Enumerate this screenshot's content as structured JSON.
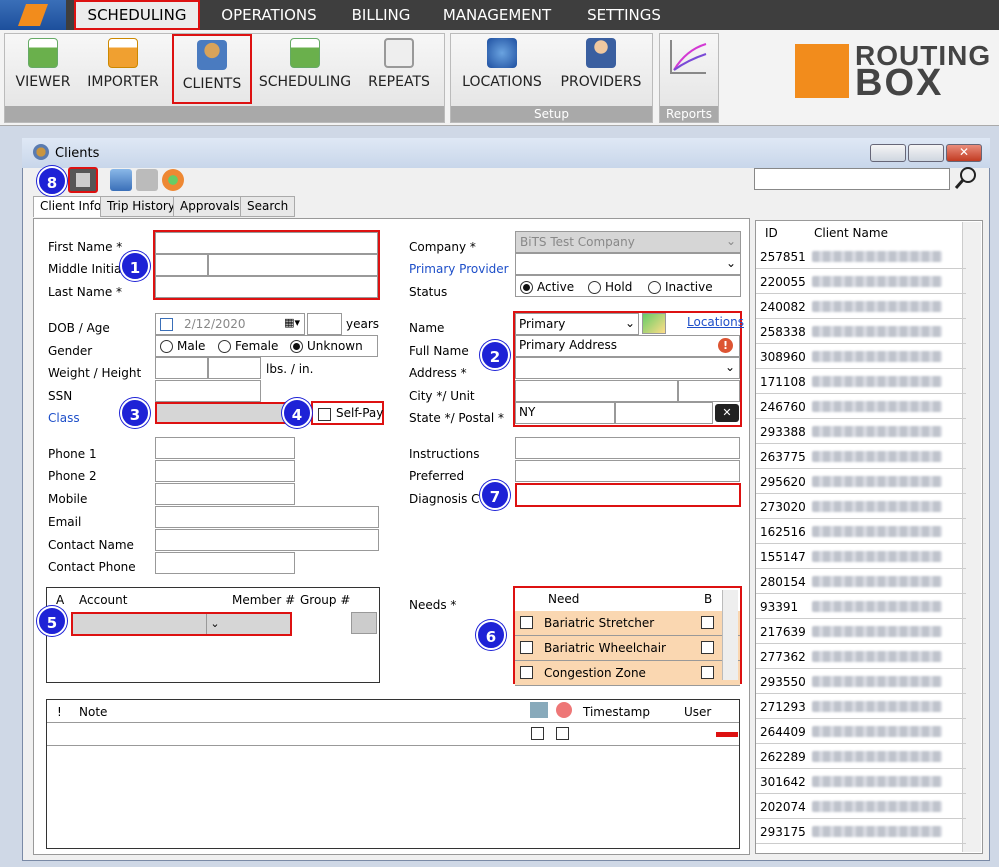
{
  "menu": {
    "items": [
      "SCHEDULING",
      "OPERATIONS",
      "BILLING",
      "MANAGEMENT",
      "SETTINGS"
    ]
  },
  "ribbon": {
    "buttons": [
      "VIEWER",
      "IMPORTER",
      "CLIENTS",
      "SCHEDULING",
      "REPEATS",
      "LOCATIONS",
      "PROVIDERS"
    ],
    "groups": [
      "Setup",
      "Reports"
    ]
  },
  "brand": {
    "line1": "ROUTING",
    "line2": "BOX"
  },
  "window": {
    "title": "Clients"
  },
  "tabs": [
    "Client Info",
    "Trip History",
    "Approvals",
    "Search"
  ],
  "form": {
    "first_name": "First Name *",
    "middle_initial": "Middle Initial",
    "last_name": "Last Name *",
    "dob": "DOB / Age",
    "dob_value": "2/12/2020",
    "years": "years",
    "gender": "Gender",
    "gender_options": [
      "Male",
      "Female",
      "Unknown"
    ],
    "weight_height": "Weight / Height",
    "lbs_in": "lbs. / in.",
    "ssn": "SSN",
    "class": "Class",
    "self_pay": "Self-Pay",
    "phone1": "Phone 1",
    "phone2": "Phone 2",
    "mobile": "Mobile",
    "email": "Email",
    "contact_name": "Contact Name",
    "contact_phone": "Contact Phone",
    "company": "Company *",
    "company_value": "BiTS Test Company",
    "primary_provider": "Primary Provider",
    "status": "Status",
    "status_options": [
      "Active",
      "Hold",
      "Inactive"
    ],
    "name": "Name",
    "name_value": "Primary",
    "locations_link": "Locations",
    "full_name": "Full Name",
    "full_name_value": "Primary Address",
    "address": "Address *",
    "city_unit": "City */ Unit",
    "state_postal": "State */ Postal *",
    "state_value": "NY",
    "instructions": "Instructions",
    "preferred": "Preferred",
    "diagnosis": "Diagnosis Code",
    "needs": "Needs *"
  },
  "account_grid": {
    "headers": [
      "A",
      "Account",
      "Member #",
      "Group #"
    ]
  },
  "needs_grid": {
    "headers": [
      "Need",
      "B"
    ],
    "rows": [
      "Bariatric Stretcher",
      "Bariatric Wheelchair",
      "Congestion Zone"
    ]
  },
  "notes_grid": {
    "headers": [
      "!",
      "Note",
      "Timestamp",
      "User"
    ]
  },
  "badges": [
    "1",
    "2",
    "3",
    "4",
    "5",
    "6",
    "7",
    "8"
  ],
  "client_list": {
    "headers": [
      "ID",
      "Client Name"
    ],
    "ids": [
      "257851",
      "220055",
      "240082",
      "258338",
      "308960",
      "171108",
      "246760",
      "293388",
      "263775",
      "295620",
      "273020",
      "162516",
      "155147",
      "280154",
      "93391",
      "217639",
      "277362",
      "293550",
      "271293",
      "264409",
      "262289",
      "301642",
      "202074",
      "293175"
    ]
  },
  "colors": {
    "accent": "#dd1111",
    "badge": "#1e22d6",
    "need_row": "#fad7b1",
    "link": "#1e4fc9"
  }
}
